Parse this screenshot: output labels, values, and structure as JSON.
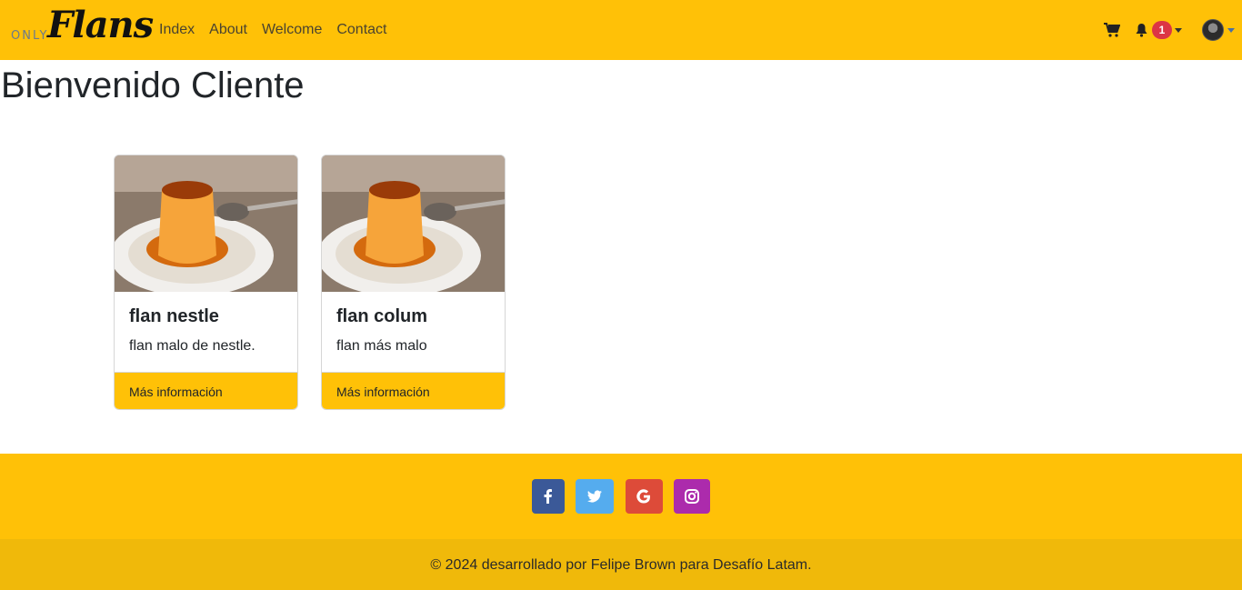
{
  "navbar": {
    "logo_small": "ONLY",
    "logo_main": "Flans",
    "links": [
      "Index",
      "About",
      "Welcome",
      "Contact"
    ],
    "notifications_count": "1"
  },
  "main": {
    "title": "Bienvenido Cliente",
    "cards": [
      {
        "title": "flan nestle",
        "text": "flan malo de nestle.",
        "link": "Más información"
      },
      {
        "title": "flan colum",
        "text": "flan más malo",
        "link": "Más información"
      }
    ]
  },
  "footer": {
    "social": [
      {
        "icon": "facebook-icon",
        "color": "#3b5998"
      },
      {
        "icon": "twitter-icon",
        "color": "#55acee"
      },
      {
        "icon": "google-icon",
        "color": "#dd4b39"
      },
      {
        "icon": "instagram-icon",
        "color": "#ac2bac"
      }
    ],
    "copyright": "© 2024 desarrollado por Felipe Brown para Desafío Latam."
  },
  "colors": {
    "accent": "#ffc107",
    "footer_bottom": "#f0b90a",
    "badge": "#dc3545"
  }
}
